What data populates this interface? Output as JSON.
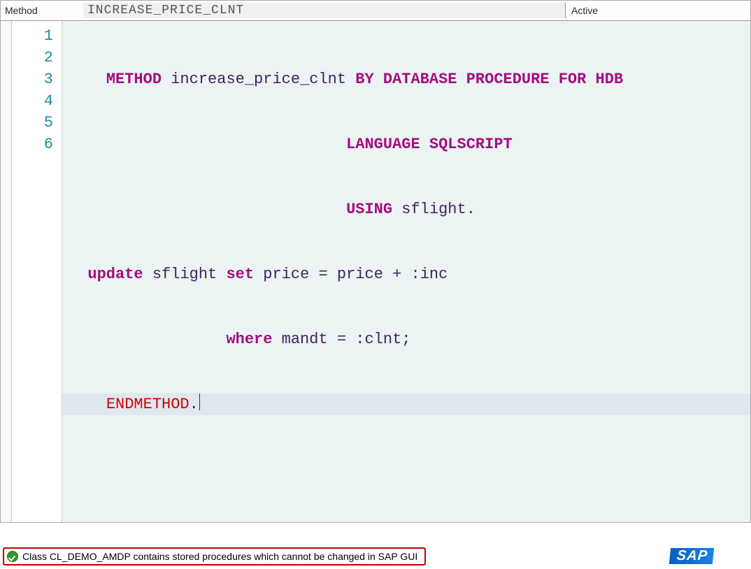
{
  "header": {
    "method_label": "Method",
    "method_name": "INCREASE_PRICE_CLNT",
    "status": "Active"
  },
  "gutter": {
    "lines": [
      "1",
      "2",
      "3",
      "4",
      "5",
      "6"
    ]
  },
  "code": {
    "l1": {
      "kw_method": "METHOD ",
      "name": "increase_price_clnt ",
      "tail": "BY DATABASE PROCEDURE FOR HDB"
    },
    "l2": {
      "text": "LANGUAGE SQLSCRIPT"
    },
    "l3": {
      "kw": "USING ",
      "arg": "sflight",
      "dot": "."
    },
    "l4": {
      "kw_update": "update ",
      "t1": "sflight ",
      "kw_set": "set ",
      "t2": "price = price + :inc"
    },
    "l5": {
      "kw_where": "where ",
      "t1": "mandt = :clnt;"
    },
    "l6": {
      "kw_end": "ENDMETHOD",
      "dot": "."
    }
  },
  "statusbar": {
    "message": "Class CL_DEMO_AMDP contains stored procedures which cannot be changed in SAP GUI",
    "brand": "SAP"
  }
}
